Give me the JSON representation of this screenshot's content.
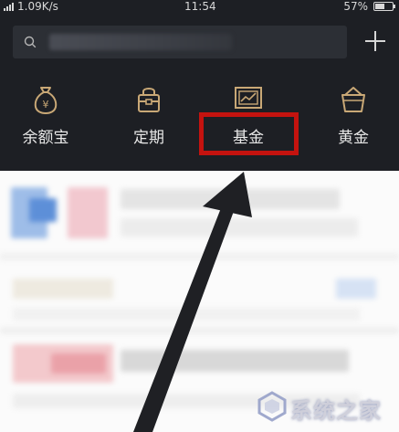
{
  "status_bar": {
    "network_speed": "1.09K/s",
    "time": "11:54",
    "battery": "57%",
    "battery_level": 0.57
  },
  "search": {
    "placeholder": ""
  },
  "nav": {
    "items": [
      {
        "label": "余额宝",
        "icon": "money-bag-icon"
      },
      {
        "label": "定期",
        "icon": "lock-box-icon"
      },
      {
        "label": "基金",
        "icon": "chart-frame-icon"
      },
      {
        "label": "黄金",
        "icon": "gold-basket-icon"
      }
    ],
    "highlighted_index": 2
  },
  "watermark": {
    "text": "系统之家"
  },
  "colors": {
    "panel_bg": "#1d1f24",
    "icon_gold": "#c9a876",
    "highlight_red": "#c4130f",
    "arrow": "#1f2024"
  }
}
